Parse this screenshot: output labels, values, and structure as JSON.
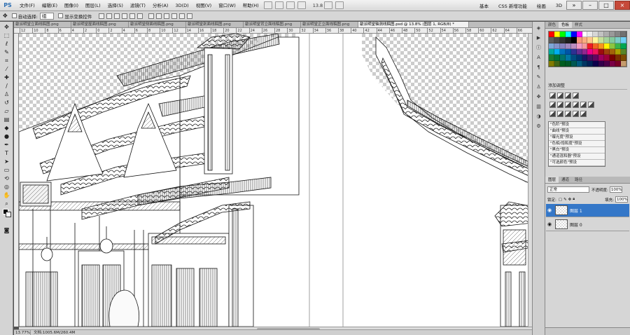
{
  "app": {
    "logo": "PS"
  },
  "menu": [
    "文件(F)",
    "编辑(E)",
    "图像(I)",
    "图层(L)",
    "选择(S)",
    "滤镜(T)",
    "分析(A)",
    "3D(D)",
    "视图(V)",
    "窗口(W)",
    "帮助(H)"
  ],
  "toolbar": {
    "zoom": "13.8"
  },
  "workspace": [
    "基本",
    "CSS 新增功能",
    "绘画",
    "3D"
  ],
  "options": {
    "auto_select_label": "自动选择:",
    "auto_select_value": "组",
    "transform_label": "显示变换控件"
  },
  "tabs": [
    {
      "label": "歙派明堂立面线稿图.png"
    },
    {
      "label": "歙派明堂屋面线稿图.png"
    },
    {
      "label": "歙派明堂侧面线稿图.png"
    },
    {
      "label": "歙派明堂剖面线稿图.png"
    },
    {
      "label": "歙派明堂背立面线稿图.png"
    },
    {
      "label": "歙派明堂正立面线稿图.png"
    },
    {
      "label": "歙派明堂轴测线稿图.psd @ 13.8% (图层 1, RGB/8) *",
      "active": true
    }
  ],
  "ruler": {
    "ticks": [
      "12",
      "10",
      "8",
      "6",
      "4",
      "2",
      "0",
      "2",
      "4",
      "6",
      "8",
      "10",
      "12",
      "14",
      "16",
      "18",
      "20",
      "22",
      "24",
      "26",
      "28",
      "30",
      "32",
      "34",
      "36",
      "38",
      "40",
      "42",
      "44",
      "46",
      "48",
      "50",
      "52",
      "54",
      "56",
      "58",
      "60",
      "62",
      "64",
      "66"
    ]
  },
  "status": {
    "zoom": "13.77%",
    "info": "文档:1005.6M/260.4M"
  },
  "panels": {
    "swatch_tabs": [
      "颜色",
      "色板",
      "样式"
    ],
    "adjust_title": "添加调整",
    "presets": [
      "\"色阶\"预设",
      "\"曲线\"预设",
      "\"曝光度\"预设",
      "\"色相/饱和度\"预设",
      "\"黑白\"预设",
      "\"通道混和器\"预设",
      "\"可选颜色\"预设"
    ],
    "layer_tabs": [
      "图层",
      "通道",
      "路径"
    ],
    "blend_mode": "正常",
    "opacity_label": "不透明度:",
    "opacity": "100%",
    "lock_label": "锁定:",
    "fill_label": "填充:",
    "fill": "100%",
    "layers": [
      {
        "name": "图层 1",
        "active": true
      },
      {
        "name": "图层 0",
        "active": false
      }
    ]
  },
  "swatch_colors": [
    "#ff0000",
    "#ffff00",
    "#00ff00",
    "#00ffff",
    "#0000ff",
    "#ff00ff",
    "#ffffff",
    "#ebebeb",
    "#d6d6d6",
    "#c2c2c2",
    "#adadad",
    "#999999",
    "#858585",
    "#707070",
    "#5c5c5c",
    "#474747",
    "#333333",
    "#1f1f1f",
    "#000000",
    "#f7977a",
    "#f9ad81",
    "#fdc68a",
    "#fff79a",
    "#c4df9b",
    "#a3d39c",
    "#82ca9d",
    "#7bcdc8",
    "#6ecff6",
    "#7ea7d8",
    "#8493ca",
    "#8882be",
    "#a187be",
    "#bc8dbf",
    "#f49ac2",
    "#f6989d",
    "#ed1c24",
    "#f26522",
    "#f7941d",
    "#fff200",
    "#8dc63f",
    "#39b54a",
    "#00a651",
    "#00a99d",
    "#00aeef",
    "#0072bc",
    "#0054a6",
    "#2e3192",
    "#662d91",
    "#92278f",
    "#ec008c",
    "#ed145b",
    "#9e0b0f",
    "#a0410d",
    "#a36209",
    "#aba000",
    "#598527",
    "#1a7b30",
    "#007236",
    "#00746b",
    "#0076a3",
    "#004b80",
    "#003471",
    "#1b1464",
    "#440e62",
    "#630460",
    "#9e005d",
    "#9e0039",
    "#790000",
    "#7b2e00",
    "#7d4900",
    "#827b00",
    "#406618",
    "#005e20",
    "#005826",
    "#005952",
    "#005b7f",
    "#003663",
    "#002157",
    "#0d004c",
    "#32004b",
    "#4b0049",
    "#7b0046",
    "#7a0026",
    "#c69c6d"
  ]
}
